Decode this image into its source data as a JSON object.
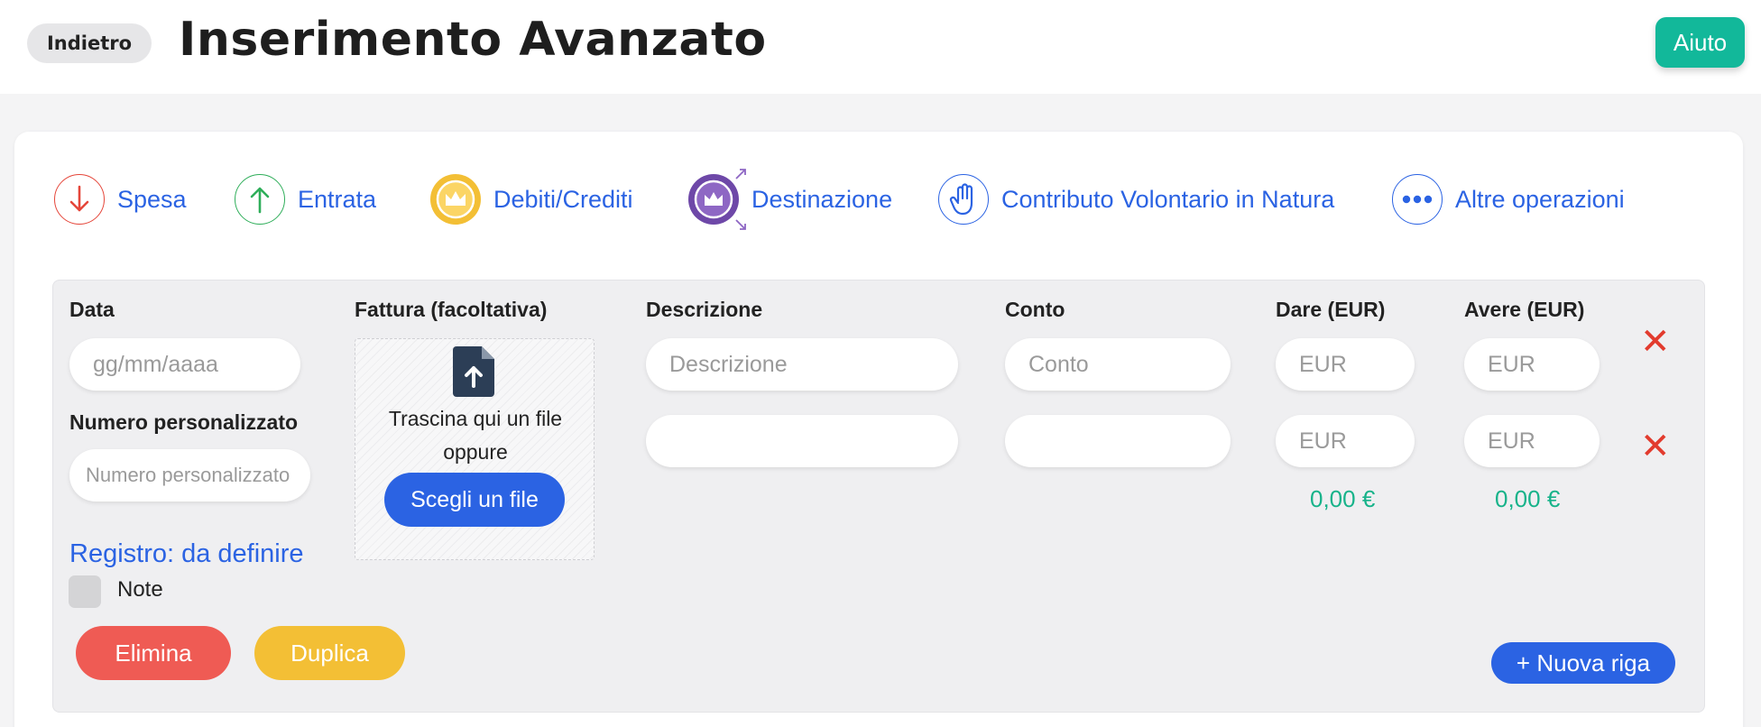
{
  "header": {
    "back_label": "Indietro",
    "title": "Inserimento Avanzato",
    "help_label": "Aiuto"
  },
  "operations": [
    {
      "label": "Spesa",
      "icon": "arrow-down-icon",
      "color": "#e5463a"
    },
    {
      "label": "Entrata",
      "icon": "arrow-up-icon",
      "color": "#2fae5a"
    },
    {
      "label": "Debiti/Crediti",
      "icon": "crown-icon",
      "color": "#f3bf35"
    },
    {
      "label": "Destinazione",
      "icon": "crown-arrows-icon",
      "color": "#6e48a8"
    },
    {
      "label": "Contributo Volontario in Natura",
      "icon": "hand-icon",
      "color": "#2b63e3"
    },
    {
      "label": "Altre operazioni",
      "icon": "more-dots-icon",
      "color": "#2b63e3"
    }
  ],
  "form": {
    "date_label": "Data",
    "date_placeholder": "gg/mm/aaaa",
    "custom_number_label": "Numero personalizzato",
    "custom_number_placeholder": "Numero personalizzato",
    "invoice_label": "Fattura (facoltativa)",
    "drop_text_1": "Trascina qui un file",
    "drop_text_2": "oppure",
    "choose_file_label": "Scegli un file",
    "description_label": "Descrizione",
    "account_label": "Conto",
    "debit_label": "Dare (EUR)",
    "credit_label": "Avere (EUR)",
    "rows": [
      {
        "description_placeholder": "Descrizione",
        "account_placeholder": "Conto",
        "debit_placeholder": "EUR",
        "credit_placeholder": "EUR"
      },
      {
        "description_placeholder": "",
        "account_placeholder": "",
        "debit_placeholder": "EUR",
        "credit_placeholder": "EUR"
      }
    ],
    "debit_total": "0,00 €",
    "credit_total": "0,00 €",
    "delete_row_symbol": "✕",
    "registro_label": "Registro: da definire",
    "note_label": "Note",
    "delete_label": "Elimina",
    "duplicate_label": "Duplica",
    "new_row_label": "+ Nuova riga"
  },
  "colors": {
    "accent_blue": "#2b63e3",
    "success_green": "#17b38a",
    "help_teal": "#12b89a",
    "danger_red": "#ef5b54",
    "warning_yellow": "#f3bf35"
  }
}
